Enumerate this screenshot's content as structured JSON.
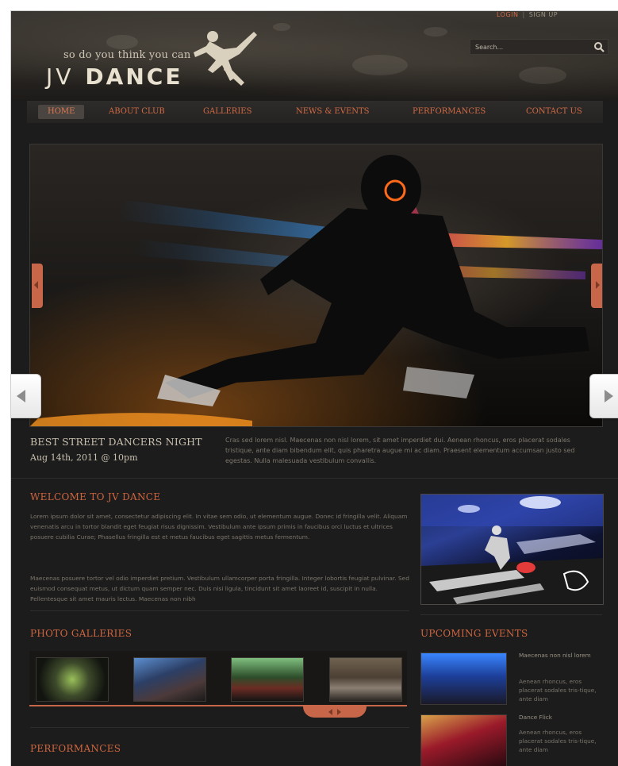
{
  "header": {
    "tagline": "so do you think you can",
    "logo_jv": "JV",
    "logo_dance": "DANCE",
    "top_links": {
      "login": "LOGIN",
      "separator": "|",
      "signup": "SIGN UP"
    },
    "search_placeholder": "Search..."
  },
  "nav": {
    "items": [
      {
        "label": "HOME"
      },
      {
        "label": "ABOUT CLUB"
      },
      {
        "label": "GALLERIES"
      },
      {
        "label": "NEWS & EVENTS"
      },
      {
        "label": "PERFORMANCES"
      },
      {
        "label": "CONTACT US"
      }
    ]
  },
  "slider": {
    "title": "BEST STREET DANCERS NIGHT",
    "date": "Aug 14th, 2011 @ 10pm",
    "text": "Cras sed lorem nisl. Maecenas non nisl lorem, sit amet imperdiet dui. Aenean rhoncus, eros placerat sodales tristique, ante diam bibendum elit, quis pharetra augue mi ac diam. Praesent elementum accumsan justo sed egestas. Nulla malesuada vestibulum convallis."
  },
  "welcome": {
    "title": "WELCOME TO JV DANCE",
    "para1": "Lorem ipsum dolor sit amet, consectetur adipiscing elit. In vitae sem odio, ut elementum augue. Donec id fringilla velit. Aliquam venenatis arcu in tortor blandit eget feugiat risus dignissim. Vestibulum ante ipsum primis in faucibus orci luctus et ultrices posuere cubilia Curae; Phasellus fringilla est et metus faucibus eget sagittis metus fermentum.",
    "para2": "Maecenas posuere tortor vel odio imperdiet pretium. Vestibulum ullamcorper porta fringilla. Integer lobortis feugiat pulvinar. Sed euismod consequat metus, ut dictum quam semper nec. Duis nisi ligula, tincidunt sit amet laoreet id, suscipit in nulla. Pellentesque sit amet mauris lectus. Maecenas non nibh"
  },
  "galleries": {
    "title": "PHOTO GALLERIES"
  },
  "events": {
    "title": "UPCOMING EVENTS",
    "items": [
      {
        "title": "Maecenas non nisl lorem",
        "text": "Aenean rhoncus, eros placerat sodales tris-tique, ante diam"
      },
      {
        "title": "Dance Flick",
        "text": "Aenean rhoncus, eros placerat sodales tris-tique, ante diam"
      }
    ]
  },
  "performances": {
    "title": "PERFORMANCES"
  },
  "colors": {
    "accent": "#d0663f",
    "background": "#1c1c1c",
    "text_muted": "#7c756b"
  }
}
